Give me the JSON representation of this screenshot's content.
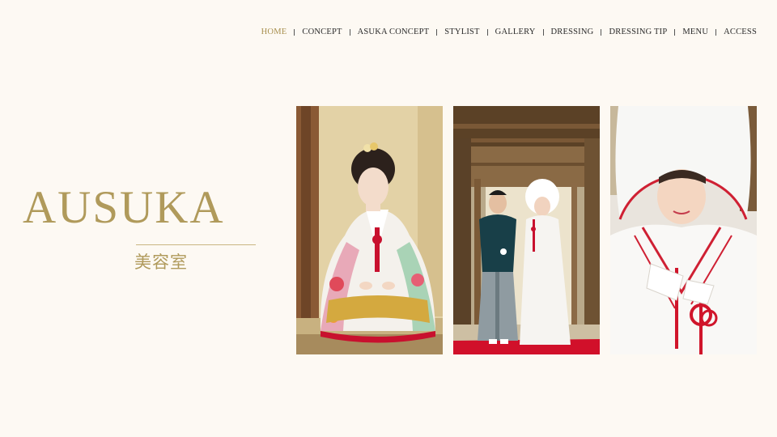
{
  "nav": {
    "items": [
      {
        "label": "HOME",
        "active": true
      },
      {
        "label": "CONCEPT",
        "active": false
      },
      {
        "label": "ASUKA CONCEPT",
        "active": false
      },
      {
        "label": "STYLIST",
        "active": false
      },
      {
        "label": "GALLERY",
        "active": false
      },
      {
        "label": "DRESSING",
        "active": false
      },
      {
        "label": "DRESSING TIP",
        "active": false
      },
      {
        "label": "MENU",
        "active": false
      },
      {
        "label": "ACCESS",
        "active": false
      }
    ]
  },
  "logo": {
    "title": "AUSUKA",
    "subtitle": "美容室"
  },
  "colors": {
    "background": "#fdf9f3",
    "accent_gold": "#b09a5b",
    "nav_active": "#a88f4e",
    "nav_text": "#2a2a2a"
  },
  "photos": [
    {
      "subject": "bride-in-colorful-uchikake"
    },
    {
      "subject": "couple-in-kimono-on-red-carpet"
    },
    {
      "subject": "bride-in-white-wataboshi"
    }
  ]
}
